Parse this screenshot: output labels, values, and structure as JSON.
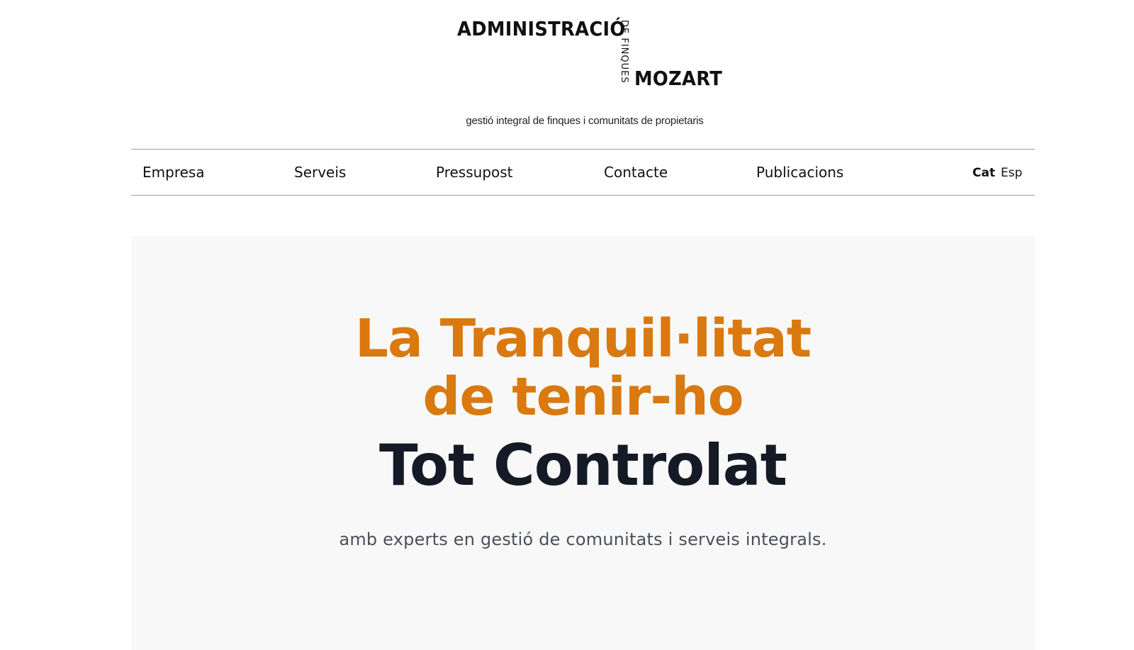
{
  "logo": {
    "administracio": "ADMINISTRACIÓ",
    "de_finques": "DE FINQUES",
    "mozart": "MOZART",
    "tagline": "gestió integral de finques i comunitats de propietaris"
  },
  "nav": {
    "items": [
      {
        "label": "Empresa"
      },
      {
        "label": "Serveis"
      },
      {
        "label": "Pressupost"
      },
      {
        "label": "Contacte"
      },
      {
        "label": "Publicacions"
      }
    ],
    "languages": {
      "cat": "Cat",
      "esp": "Esp",
      "active": "Cat"
    }
  },
  "hero": {
    "line1": "La Tranquil·litat",
    "line2": "de tenir-ho",
    "line3": "Tot Controlat",
    "subtitle": "amb experts en gestió de comunitats i serveis integrals."
  },
  "colors": {
    "accent": "#d9790f",
    "dark": "#141a26",
    "hero_bg": "#f8f8f8"
  }
}
